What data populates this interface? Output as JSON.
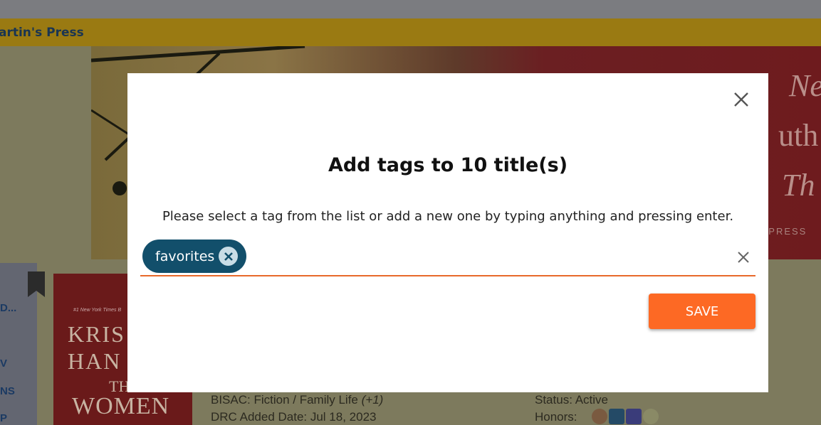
{
  "background": {
    "publisher": "artin's Press",
    "banner": {
      "line1": "Ne",
      "line2": "uth",
      "line3": "Th",
      "press": "S PRESS"
    },
    "side_items": [
      "D...",
      "V",
      "NS",
      "P"
    ],
    "cover": {
      "small_text": "#1 New York Times B",
      "author_line1": "KRIS",
      "author_line2": "HAN",
      "the": "TH",
      "title": "WOMEN"
    },
    "meta": {
      "bisac_label": "BISAC: Fiction / Family Life",
      "bisac_extra": "(+1)",
      "drc_added": "DRC Added Date: Jul 18, 2023",
      "status": "Status: Active",
      "honors_label": "Honors:"
    }
  },
  "modal": {
    "title": "Add tags to 10 title(s)",
    "instructions": "Please select a tag from the list or add a new one by typing anything and pressing enter.",
    "tags": [
      {
        "label": "favorites"
      }
    ],
    "input_value": "",
    "save_label": "SAVE"
  },
  "colors": {
    "accent": "#fd6924",
    "chip": "#124f6b",
    "underline": "#e8692a"
  }
}
